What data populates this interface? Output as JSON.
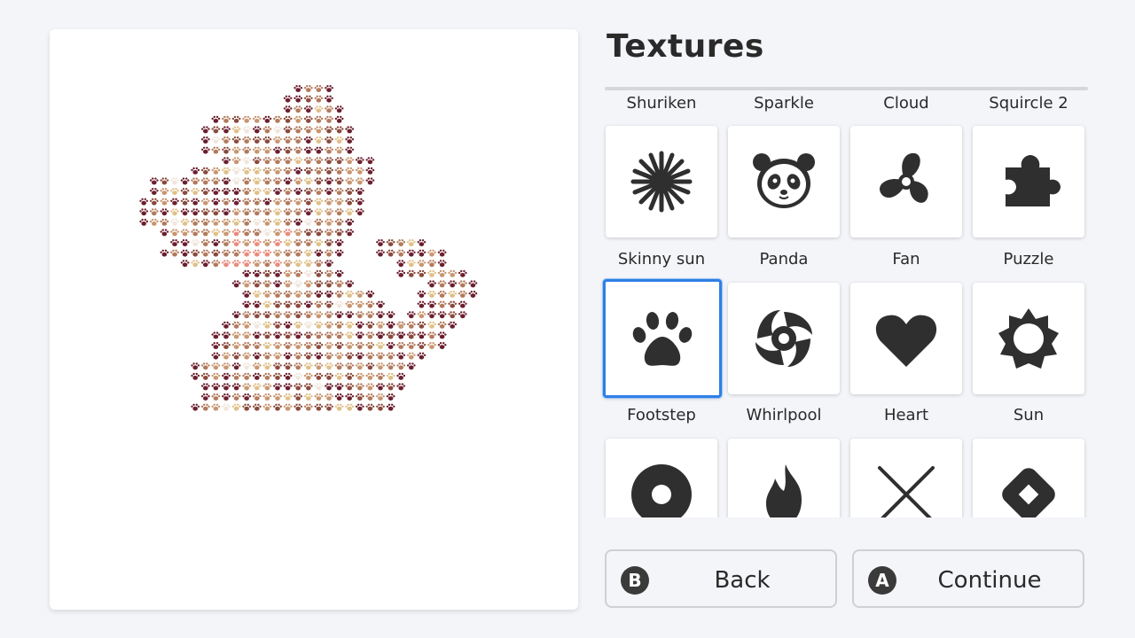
{
  "title": "Textures",
  "textures": {
    "rows": [
      {
        "labels": [
          "Shuriken",
          "Sparkle",
          "Cloud",
          "Squircle 2"
        ],
        "cells": []
      },
      {
        "labels": [
          "Skinny sun",
          "Panda",
          "Fan",
          "Puzzle"
        ],
        "cells": [
          "skinny-sun-icon",
          "panda-icon",
          "fan-icon",
          "puzzle-icon"
        ]
      },
      {
        "labels": [
          "Footstep",
          "Whirlpool",
          "Heart",
          "Sun"
        ],
        "cells": [
          "paw-icon",
          "whirlpool-icon",
          "heart-icon",
          "sun-icon"
        ]
      },
      {
        "labels": [],
        "cells": [
          "donut-icon",
          "flame-icon",
          "cross-icon",
          "diamond-icon"
        ]
      }
    ],
    "selected": "Footstep"
  },
  "buttons": {
    "back": {
      "badge": "B",
      "label": "Back"
    },
    "continue": {
      "badge": "A",
      "label": "Continue"
    }
  },
  "colors": {
    "selection": "#2f7fe6",
    "icon": "#2f2f2f",
    "paw_palette": [
      "#6b1f2e",
      "#8a4a3c",
      "#b27a5c",
      "#c89670",
      "#dfc088",
      "#e98a7c",
      "#f0e6dc"
    ]
  }
}
